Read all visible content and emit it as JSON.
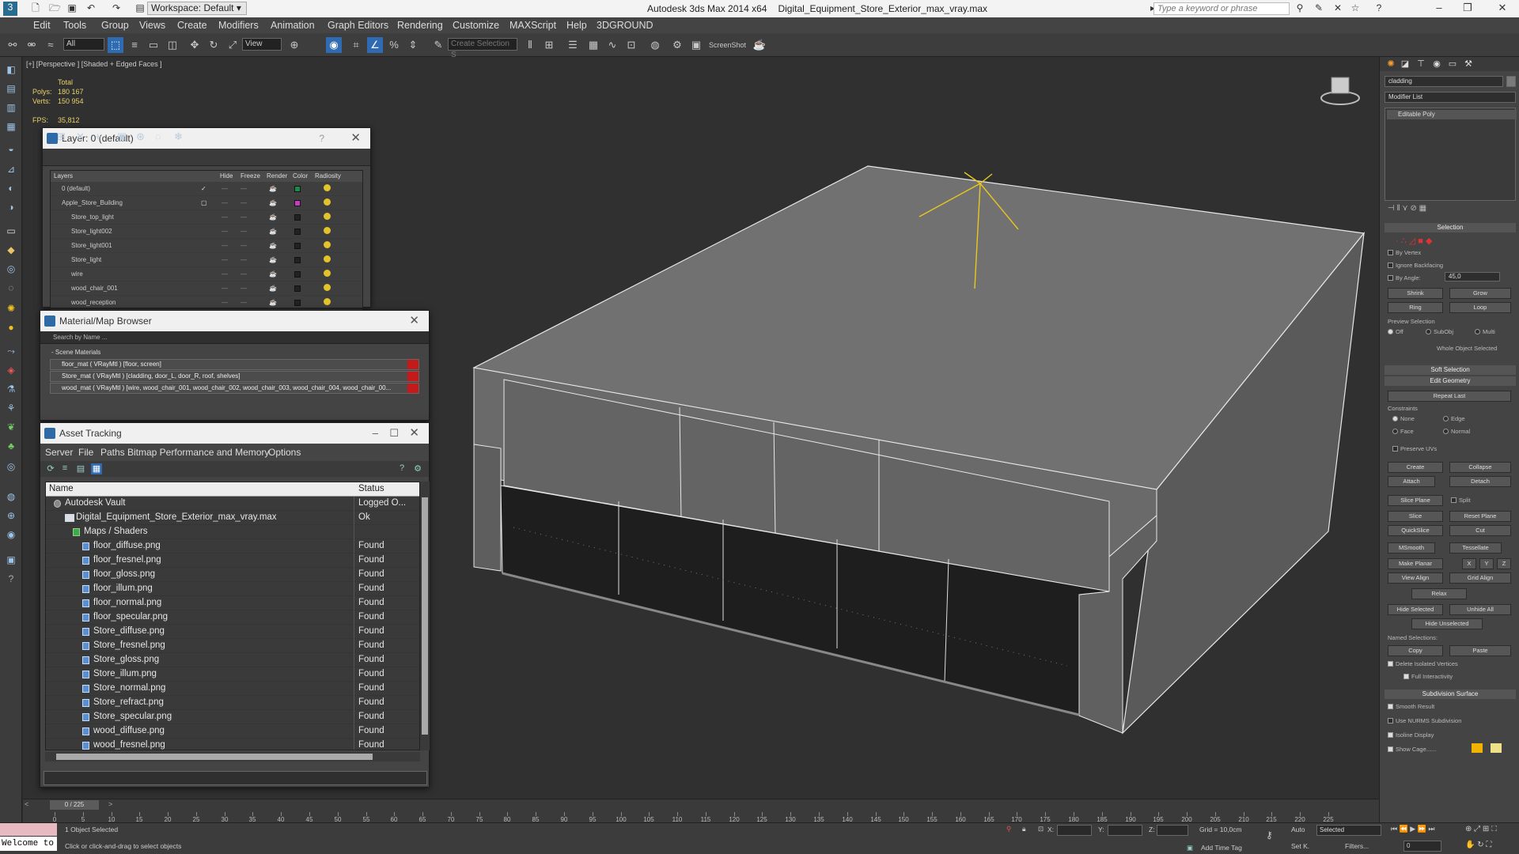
{
  "titlebar": {
    "workspace": "Workspace: Default",
    "app": "Autodesk 3ds Max  2014 x64",
    "file": "Digital_Equipment_Store_Exterior_max_vray.max",
    "search_placeholder": "Type a keyword or phrase"
  },
  "menu": [
    "Edit",
    "Tools",
    "Group",
    "Views",
    "Create",
    "Modifiers",
    "Animation",
    "Graph Editors",
    "Rendering",
    "Customize",
    "MAXScript",
    "Help",
    "3DGROUND"
  ],
  "toolbar": {
    "filter": "All",
    "refcoord": "View",
    "named_sel": "Create Selection S",
    "screenshot": "ScreenShot"
  },
  "viewport": {
    "label": "[+] [Perspective ] [Shaded + Edged Faces ]",
    "stats_total": "Total",
    "polys_label": "Polys:",
    "polys": "180 167",
    "verts_label": "Verts:",
    "verts": "150 954",
    "fps_label": "FPS:",
    "fps": "35,812"
  },
  "layer_panel": {
    "title": "Layer: 0 (default)",
    "help": "?",
    "columns": [
      "Layers",
      "Hide",
      "Freeze",
      "Render",
      "Color",
      "Radiosity"
    ],
    "rows": [
      {
        "name": "0 (default)",
        "indent": 1,
        "color": "#1a8a4a"
      },
      {
        "name": "Apple_Store_Building",
        "indent": 1,
        "color": "#c63bbf"
      },
      {
        "name": "Store_top_light",
        "indent": 2,
        "color": "#222222"
      },
      {
        "name": "Store_light002",
        "indent": 2,
        "color": "#222222"
      },
      {
        "name": "Store_light001",
        "indent": 2,
        "color": "#222222"
      },
      {
        "name": "Store_light",
        "indent": 2,
        "color": "#222222"
      },
      {
        "name": "wire",
        "indent": 2,
        "color": "#222222"
      },
      {
        "name": "wood_chair_001",
        "indent": 2,
        "color": "#222222"
      },
      {
        "name": "wood_reception",
        "indent": 2,
        "color": "#222222"
      }
    ]
  },
  "material_panel": {
    "title": "Material/Map Browser",
    "search": "Search by Name ...",
    "group": "- Scene Materials",
    "materials": [
      "floor_mat  ( VRayMtl ) [floor, screen]",
      "Store_mat  ( VRayMtl ) [cladding, door_L, door_R, roof, shelves]",
      "wood_mat  ( VRayMtl ) [wire, wood_chair_001, wood_chair_002, wood_chair_003, wood_chair_004, wood_chair_00..."
    ]
  },
  "asset_panel": {
    "title": "Asset Tracking",
    "menu": [
      "Server",
      "File",
      "Paths",
      "Bitmap Performance and Memory",
      "Options"
    ],
    "col_name": "Name",
    "col_status": "Status",
    "rows": [
      {
        "name": "Autodesk Vault",
        "status": "Logged O...",
        "indent": 0
      },
      {
        "name": "Digital_Equipment_Store_Exterior_max_vray.max",
        "status": "Ok",
        "indent": 1
      },
      {
        "name": "Maps / Shaders",
        "status": "",
        "indent": 2
      },
      {
        "name": "floor_diffuse.png",
        "status": "Found",
        "indent": 3
      },
      {
        "name": "floor_fresnel.png",
        "status": "Found",
        "indent": 3
      },
      {
        "name": "floor_gloss.png",
        "status": "Found",
        "indent": 3
      },
      {
        "name": "floor_illum.png",
        "status": "Found",
        "indent": 3
      },
      {
        "name": "floor_normal.png",
        "status": "Found",
        "indent": 3
      },
      {
        "name": "floor_specular.png",
        "status": "Found",
        "indent": 3
      },
      {
        "name": "Store_diffuse.png",
        "status": "Found",
        "indent": 3
      },
      {
        "name": "Store_fresnel.png",
        "status": "Found",
        "indent": 3
      },
      {
        "name": "Store_gloss.png",
        "status": "Found",
        "indent": 3
      },
      {
        "name": "Store_illum.png",
        "status": "Found",
        "indent": 3
      },
      {
        "name": "Store_normal.png",
        "status": "Found",
        "indent": 3
      },
      {
        "name": "Store_refract.png",
        "status": "Found",
        "indent": 3
      },
      {
        "name": "Store_specular.png",
        "status": "Found",
        "indent": 3
      },
      {
        "name": "wood_diffuse.png",
        "status": "Found",
        "indent": 3
      },
      {
        "name": "wood_fresnel.png",
        "status": "Found",
        "indent": 3
      }
    ]
  },
  "command_panel": {
    "object_name": "cladding",
    "modifier_list": "Modifier List",
    "stack_item": "Editable Poly",
    "selection": "Selection",
    "by_vertex": "By Vertex",
    "ignore_backfacing": "Ignore Backfacing",
    "by_angle": "By Angle:",
    "angle": "45,0",
    "shrink": "Shrink",
    "grow": "Grow",
    "ring": "Ring",
    "loop": "Loop",
    "preview_selection": "Preview Selection",
    "off": "Off",
    "subobj": "SubObj",
    "multi": "Multi",
    "whole_object": "Whole Object Selected",
    "soft_selection": "Soft Selection",
    "edit_geometry": "Edit Geometry",
    "repeat_last": "Repeat Last",
    "constraints": "Constraints",
    "none": "None",
    "edge": "Edge",
    "face": "Face",
    "normal": "Normal",
    "preserve_uvs": "Preserve UVs",
    "create": "Create",
    "collapse": "Collapse",
    "attach": "Attach",
    "detach": "Detach",
    "slice_plane": "Slice Plane",
    "split": "Split",
    "slice": "Slice",
    "reset_plane": "Reset Plane",
    "quickslice": "QuickSlice",
    "cut": "Cut",
    "msmooth": "MSmooth",
    "tessellate": "Tessellate",
    "make_planar": "Make Planar",
    "x": "X",
    "y": "Y",
    "z": "Z",
    "view_align": "View Align",
    "grid_align": "Grid Align",
    "relax": "Relax",
    "hide_selected": "Hide Selected",
    "unhide_all": "Unhide All",
    "hide_unselected": "Hide Unselected",
    "named_selections": "Named Selections:",
    "copy": "Copy",
    "paste": "Paste",
    "delete_isolated": "Delete Isolated Vertices",
    "full_interactivity": "Full Interactivity",
    "subdivision_surface": "Subdivision Surface",
    "smooth_result": "Smooth Result",
    "use_nurms": "Use NURMS Subdivision",
    "isoline": "Isoline Display",
    "show_cage": "Show Cage......"
  },
  "timeline": {
    "slider": "0 / 225",
    "ticks": [
      0,
      5,
      10,
      15,
      20,
      25,
      30,
      35,
      40,
      45,
      50,
      55,
      60,
      65,
      70,
      75,
      80,
      85,
      90,
      95,
      100,
      105,
      110,
      115,
      120,
      125,
      130,
      135,
      140,
      145,
      150,
      155,
      160,
      165,
      170,
      175,
      180,
      185,
      190,
      195,
      200,
      205,
      210,
      215,
      220,
      225
    ]
  },
  "statusbar": {
    "welcome": "Welcome to",
    "selected": "1 Object Selected",
    "prompt": "Click or click-and-drag to select objects",
    "x_label": "X:",
    "y_label": "Y:",
    "z_label": "Z:",
    "grid": "Grid = 10,0cm",
    "add_time_tag": "Add Time Tag",
    "auto": "Auto",
    "selected_dd": "Selected",
    "set_k": "Set K.",
    "filters": "Filters...",
    "frame": "0"
  },
  "colors": {
    "viewport_bg": "#303030",
    "wire": "#ffffff",
    "gizmo": "#e8c81c",
    "material_tag": "#c41a1a"
  }
}
